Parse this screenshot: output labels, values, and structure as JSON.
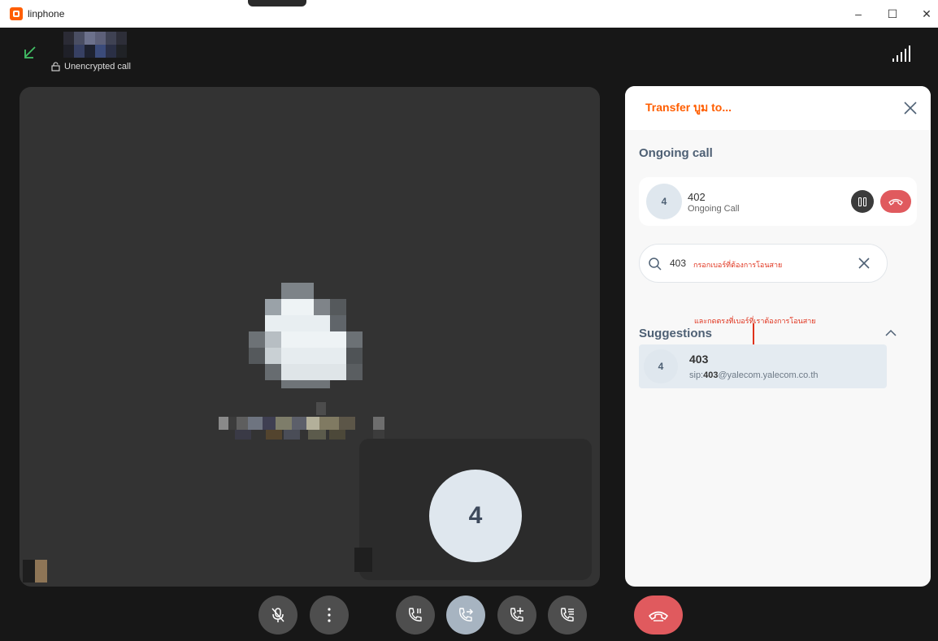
{
  "window": {
    "title": "linphone",
    "minimize": "–",
    "maximize": "☐",
    "close": "✕"
  },
  "header": {
    "encryption_label": "Unencrypted call"
  },
  "pip": {
    "avatar_initial": "4"
  },
  "transfer_panel": {
    "title": "Transfer บูม to...",
    "ongoing_section": "Ongoing call",
    "ongoing": {
      "avatar_initial": "4",
      "number": "402",
      "status": "Ongoing Call"
    },
    "search": {
      "value": "403",
      "annotation": "กรอกเบอร์ที่ต้องการโอนสาย"
    },
    "suggestions_annotation": "และกดตรงที่เบอร์ที่เราต้องการโอนสาย",
    "suggestions_section": "Suggestions",
    "suggestion": {
      "avatar_initial": "4",
      "number": "403",
      "sip_prefix": "sip:",
      "sip_user": "403",
      "sip_domain": "@yalecom.yalecom.co.th"
    }
  },
  "toolbar": {
    "buttons": [
      {
        "icon": "mic-off-icon"
      },
      {
        "icon": "more-vertical-icon"
      },
      {
        "icon": "call-pause-icon"
      },
      {
        "icon": "call-transfer-icon",
        "active": true
      },
      {
        "icon": "add-call-icon"
      },
      {
        "icon": "call-list-icon"
      },
      {
        "icon": "hang-up-icon"
      }
    ]
  },
  "colors": {
    "accent": "#ff5e00",
    "hangup": "#e05a5e",
    "panel_bg": "#f8f8f8",
    "active_btn": "#a7b4c1",
    "annotation": "#e0321c"
  }
}
